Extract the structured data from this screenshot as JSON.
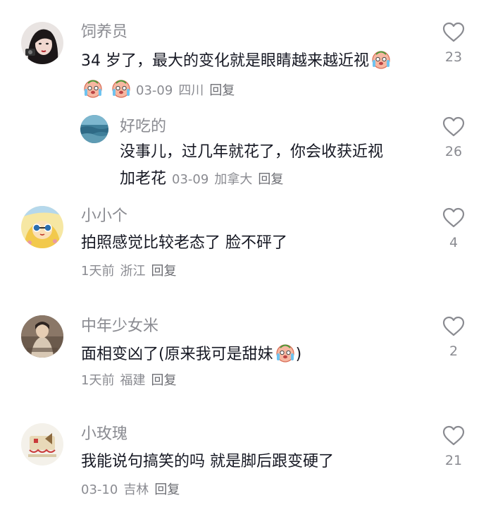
{
  "comments": [
    {
      "username": "饲养员",
      "text_line1": "34 岁了，最大的变化就是眼睛越来越近视",
      "date": "03-09",
      "location": "四川",
      "reply_label": "回复",
      "likes": "23",
      "emoji": "crying-face-icon"
    },
    {
      "username": "好吃的",
      "text_line1": "没事儿，过几年就花了，你会收获近视",
      "text_line2": "加老花",
      "date": "03-09",
      "location": "加拿大",
      "reply_label": "回复",
      "likes": "26"
    },
    {
      "username": "小小个",
      "text_line1": "拍照感觉比较老态了  脸不砰了",
      "date": "1天前",
      "location": "浙江",
      "reply_label": "回复",
      "likes": "4"
    },
    {
      "username": "中年少女米",
      "text_line1": "面相变凶了(原来我可是甜妹",
      "text_line1_end": ")",
      "date": "1天前",
      "location": "福建",
      "reply_label": "回复",
      "likes": "2",
      "emoji": "crying-face-icon"
    },
    {
      "username": "小玫瑰",
      "text_line1": "我能说句搞笑的吗 就是脚后跟变硬了",
      "date": "03-10",
      "location": "吉林",
      "reply_label": "回复",
      "likes": "21"
    }
  ],
  "colors": {
    "text": "#161823",
    "muted": "#8a8b91",
    "heart_stroke": "#8a8b91"
  }
}
